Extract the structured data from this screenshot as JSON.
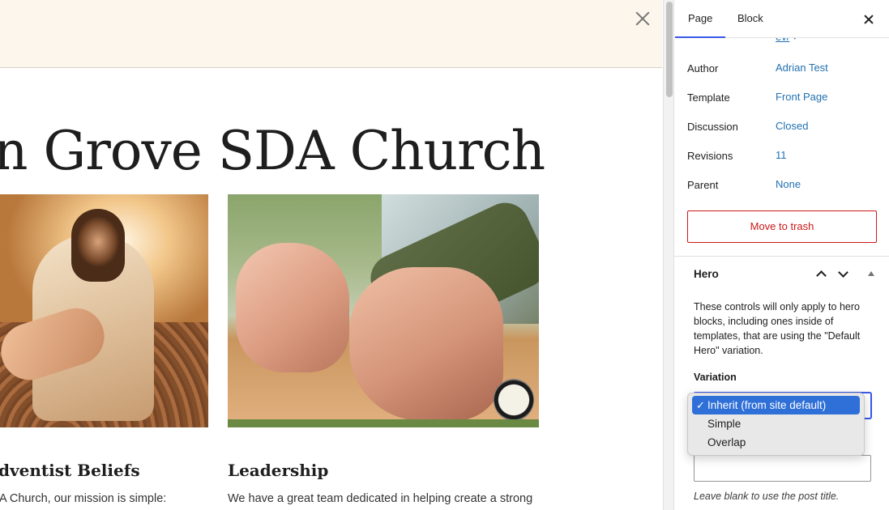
{
  "canvas": {
    "site_title": "n Grove SDA Church",
    "columns": [
      {
        "heading": "dventist Beliefs",
        "text": "A Church, our mission is simple:"
      },
      {
        "heading": "Leadership",
        "text": "We have a great team dedicated in helping create a strong"
      }
    ]
  },
  "sidebar": {
    "tabs": [
      {
        "label": "Page"
      },
      {
        "label": "Block"
      }
    ],
    "active_tab": "Page",
    "slug_link": "ev/",
    "slug_icon": "↗",
    "rows": [
      {
        "label": "Author",
        "value": "Adrian Test"
      },
      {
        "label": "Template",
        "value": "Front Page"
      },
      {
        "label": "Discussion",
        "value": "Closed"
      },
      {
        "label": "Revisions",
        "value": "11"
      },
      {
        "label": "Parent",
        "value": "None"
      }
    ],
    "trash_button": "Move to trash",
    "panel": {
      "title": "Hero",
      "description": "These controls will only apply to hero blocks, including ones inside of templates, that are using the \"Default Hero\" variation.",
      "variation_label": "Variation",
      "title_input_value": "",
      "help_text": "Leave blank to use the post title."
    }
  },
  "dropdown": {
    "check": "✓",
    "options": [
      {
        "label": "Inherit (from site default)",
        "selected": true
      },
      {
        "label": "Simple",
        "selected": false
      },
      {
        "label": "Overlap",
        "selected": false
      }
    ]
  },
  "colors": {
    "accent": "#3858e9",
    "link": "#2271b1",
    "danger": "#cc1818",
    "notice_bg": "#fdf6ec",
    "option_highlight": "#2f6fd8"
  },
  "icons": [
    "close-icon",
    "external-link-icon",
    "chevron-up-icon",
    "chevron-down-icon",
    "collapse-triangle-icon",
    "checkmark-icon"
  ]
}
